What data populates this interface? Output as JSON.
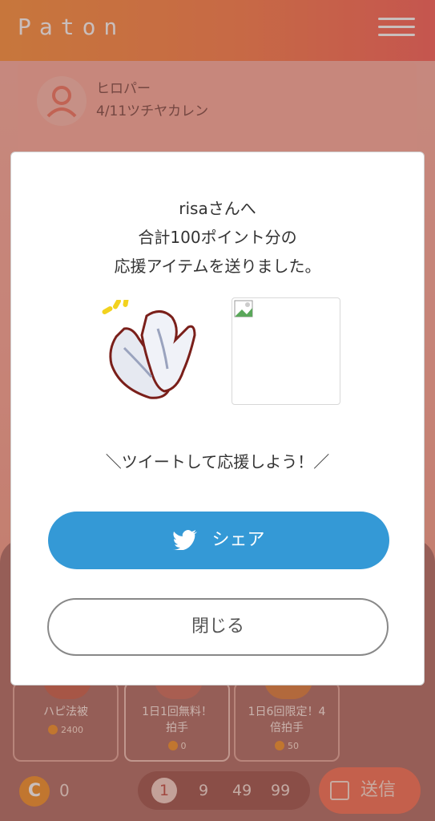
{
  "header": {
    "logo": "Paton"
  },
  "profile": {
    "name": "ヒロパー",
    "subtitle": "4/11ツチヤカレン"
  },
  "modal": {
    "line1": "risaさんへ",
    "line2": "合計100ポイント分の",
    "line3": "応援アイテムを送りました。",
    "tweet_prompt": "＼ツイートして応援しよう！／",
    "share_label": "シェア",
    "close_label": "閉じる"
  },
  "items": [
    {
      "label": "ハピ法被",
      "price": "2400"
    },
    {
      "label": "1日1回無料！拍手",
      "price": "0"
    },
    {
      "label": "1日6回限定！4倍拍手",
      "price": "50"
    }
  ],
  "footer": {
    "coin_symbol": "C",
    "coin_count": "0",
    "qty_options": [
      "1",
      "9",
      "49",
      "99"
    ],
    "send_label": "送信"
  },
  "colors": {
    "accent": "#fc8a5b",
    "twitter": "#3499d6"
  }
}
